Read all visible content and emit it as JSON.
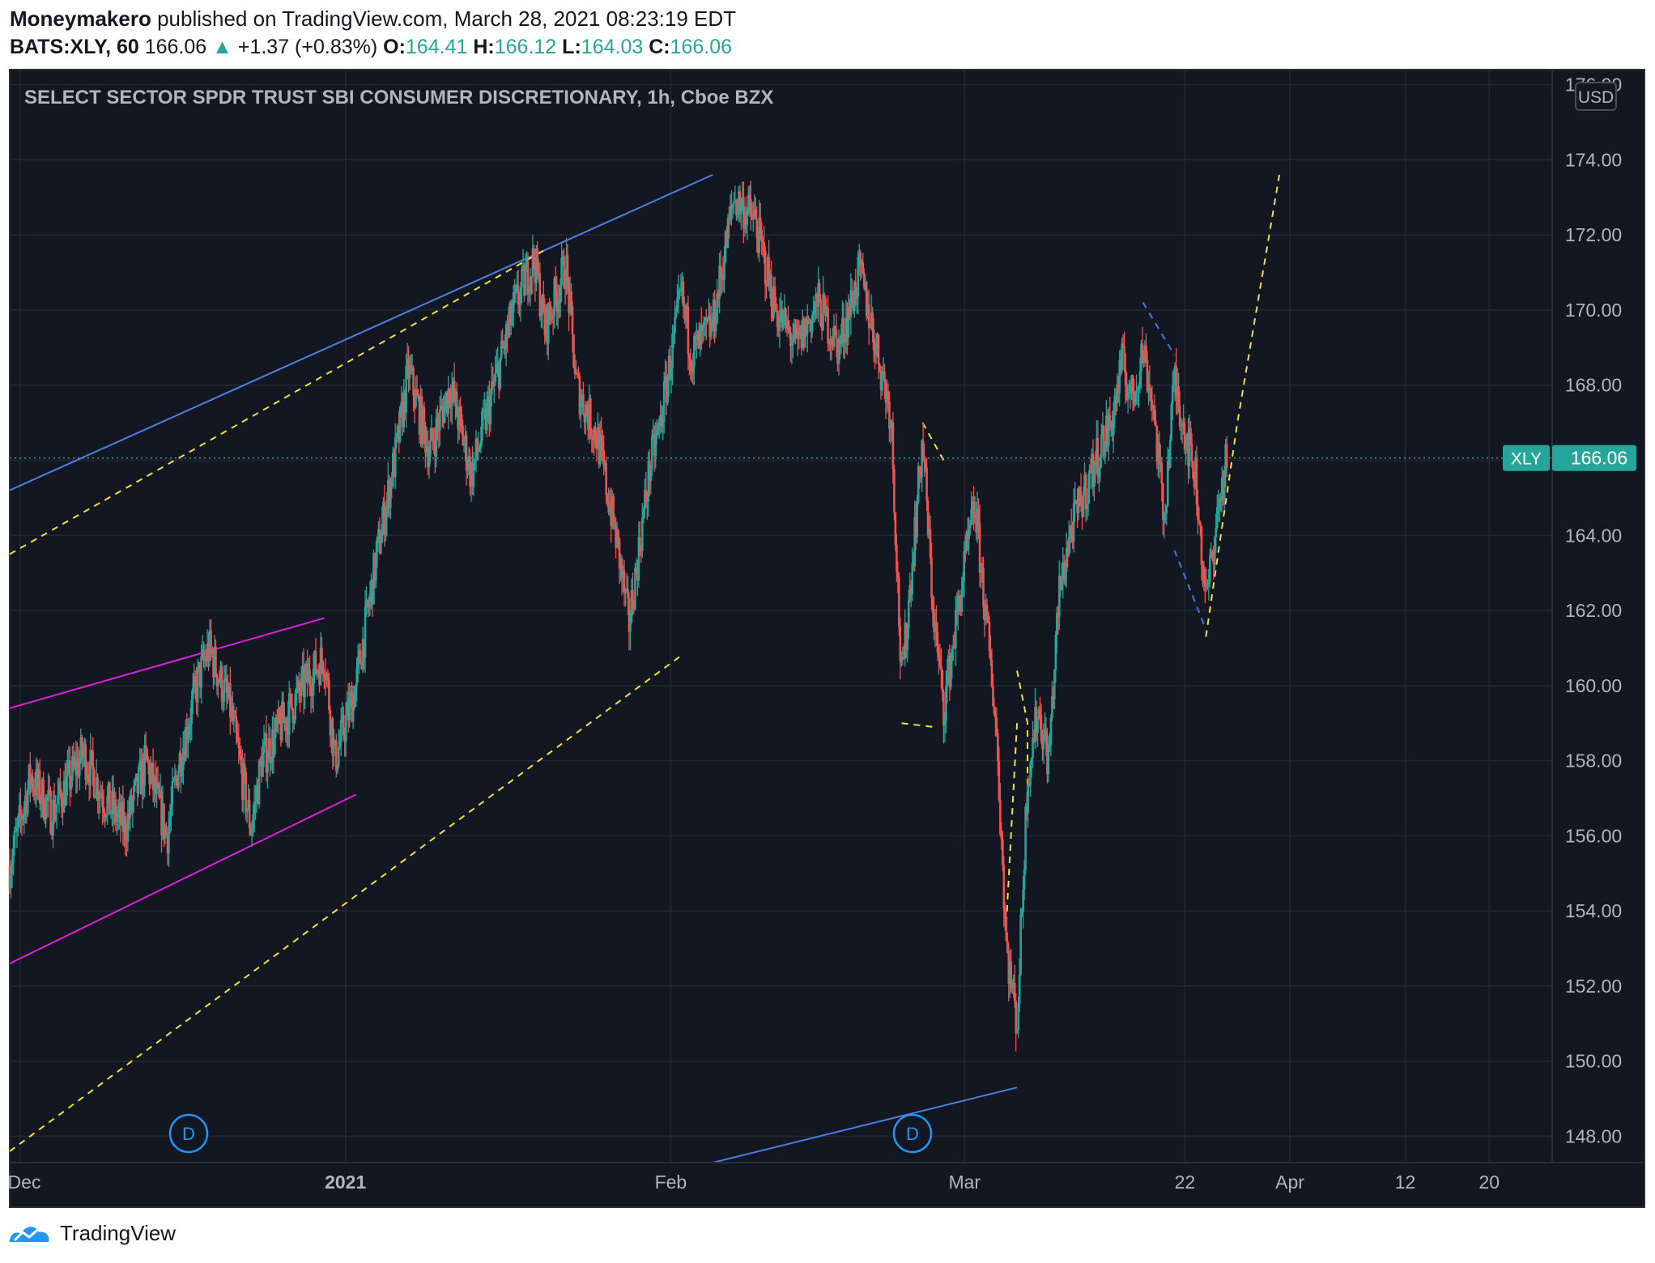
{
  "header": {
    "author": "Moneymakero",
    "published_text": "published on TradingView.com, March 28, 2021 08:23:19 EDT",
    "symbol": "BATS:XLY, 60",
    "last": "166.06",
    "change_arrow": "▲",
    "change": "+1.37 (+0.83%)",
    "o_label": "O:",
    "o_value": "164.41",
    "h_label": "H:",
    "h_value": "166.12",
    "l_label": "L:",
    "l_value": "164.03",
    "c_label": "C:",
    "c_value": "166.06"
  },
  "chart_title": "SELECT SECTOR SPDR TRUST SBI CONSUMER DISCRETIONARY, 1h, Cboe BZX",
  "currency_label": "USD",
  "price_badge": {
    "symbol": "XLY",
    "value": "166.06"
  },
  "dividend_markers": [
    "D",
    "D"
  ],
  "footer_brand": "TradingView",
  "colors": {
    "background": "#131722",
    "grid": "#242833",
    "up": "#26a69a",
    "down": "#ef5350",
    "axis_text": "#b2b5be",
    "blue_line": "#4c7fe0",
    "magenta_line": "#e020d8",
    "yellow_dash": "#f3e23a",
    "blue_dash": "#3d7fe6"
  },
  "chart_data": {
    "type": "candlestick",
    "title": "SELECT SECTOR SPDR TRUST SBI CONSUMER DISCRETIONARY, 1h, Cboe BZX",
    "last_price": 166.06,
    "y_axis": {
      "ticks": [
        148,
        150,
        152,
        154,
        156,
        158,
        160,
        162,
        164,
        166,
        168,
        170,
        172,
        174,
        176
      ],
      "tick_labels": [
        "148.00",
        "150.00",
        "152.00",
        "154.00",
        "156.00",
        "158.00",
        "160.00",
        "162.00",
        "164.00",
        "166.00",
        "168.00",
        "170.00",
        "172.00",
        "174.00",
        "176.00"
      ],
      "ylim": [
        147.3,
        176.4
      ]
    },
    "x_axis": {
      "tick_labels": [
        "Dec",
        "2021",
        "Feb",
        "Mar",
        "22",
        "Apr",
        "12",
        "20"
      ],
      "tick_dates": [
        "2020-12-01",
        "2021-01-01",
        "2021-02-01",
        "2021-03-01",
        "2021-03-22",
        "2021-04-01",
        "2021-04-12",
        "2021-04-20"
      ],
      "xlim": [
        "2020-11-30",
        "2021-04-26"
      ]
    },
    "grid": true,
    "price_path": [
      [
        "2020-11-30",
        155.2
      ],
      [
        "2020-12-02",
        157.6
      ],
      [
        "2020-12-04",
        156.6
      ],
      [
        "2020-12-07",
        158.2
      ],
      [
        "2020-12-09",
        157.0
      ],
      [
        "2020-12-11",
        156.2
      ],
      [
        "2020-12-13",
        158.0
      ],
      [
        "2020-12-15",
        156.0
      ],
      [
        "2020-12-16",
        157.8
      ],
      [
        "2020-12-18",
        160.2
      ],
      [
        "2020-12-19",
        161.0
      ],
      [
        "2020-12-21",
        159.4
      ],
      [
        "2020-12-23",
        156.2
      ],
      [
        "2020-12-24",
        158.0
      ],
      [
        "2020-12-26",
        159.0
      ],
      [
        "2020-12-28",
        160.0
      ],
      [
        "2020-12-30",
        160.8
      ],
      [
        "2020-12-31",
        158.0
      ],
      [
        "2021-01-02",
        160.0
      ],
      [
        "2021-01-04",
        163.5
      ],
      [
        "2021-01-06",
        166.5
      ],
      [
        "2021-01-07",
        168.4
      ],
      [
        "2021-01-09",
        166.2
      ],
      [
        "2021-01-11",
        168.0
      ],
      [
        "2021-01-13",
        165.6
      ],
      [
        "2021-01-15",
        167.8
      ],
      [
        "2021-01-17",
        170.0
      ],
      [
        "2021-01-19",
        171.4
      ],
      [
        "2021-01-20",
        169.5
      ],
      [
        "2021-01-22",
        171.2
      ],
      [
        "2021-01-23",
        168.0
      ],
      [
        "2021-01-25",
        166.6
      ],
      [
        "2021-01-27",
        163.6
      ],
      [
        "2021-01-28",
        161.6
      ],
      [
        "2021-01-30",
        165.8
      ],
      [
        "2021-01-31",
        167.0
      ],
      [
        "2021-02-02",
        170.4
      ],
      [
        "2021-02-03",
        168.8
      ],
      [
        "2021-02-05",
        169.6
      ],
      [
        "2021-02-07",
        173.0
      ],
      [
        "2021-02-09",
        172.4
      ],
      [
        "2021-02-11",
        170.0
      ],
      [
        "2021-02-13",
        169.0
      ],
      [
        "2021-02-15",
        170.2
      ],
      [
        "2021-02-17",
        169.0
      ],
      [
        "2021-02-19",
        171.0
      ],
      [
        "2021-02-20",
        169.8
      ],
      [
        "2021-02-22",
        167.2
      ],
      [
        "2021-02-23",
        160.0
      ],
      [
        "2021-02-25",
        166.6
      ],
      [
        "2021-02-26",
        162.0
      ],
      [
        "2021-02-27",
        159.4
      ],
      [
        "2021-03-01",
        163.2
      ],
      [
        "2021-03-02",
        164.8
      ],
      [
        "2021-03-04",
        159.0
      ],
      [
        "2021-03-05",
        153.0
      ],
      [
        "2021-03-06",
        151.0
      ],
      [
        "2021-03-07",
        157.6
      ],
      [
        "2021-03-08",
        159.4
      ],
      [
        "2021-03-09",
        158.0
      ],
      [
        "2021-03-10",
        162.4
      ],
      [
        "2021-03-11",
        164.0
      ],
      [
        "2021-03-13",
        165.6
      ],
      [
        "2021-03-14",
        166.4
      ],
      [
        "2021-03-15",
        167.0
      ],
      [
        "2021-03-16",
        168.6
      ],
      [
        "2021-03-17",
        167.6
      ],
      [
        "2021-03-18",
        169.0
      ],
      [
        "2021-03-19",
        167.4
      ],
      [
        "2021-03-20",
        164.4
      ],
      [
        "2021-03-21",
        168.2
      ],
      [
        "2021-03-22",
        166.8
      ],
      [
        "2021-03-23",
        165.6
      ],
      [
        "2021-03-24",
        162.2
      ],
      [
        "2021-03-25",
        164.4
      ],
      [
        "2021-03-26",
        166.06
      ]
    ],
    "drawings": [
      {
        "kind": "line",
        "color": "blue",
        "points": [
          [
            "2020-11-30",
            165.2
          ],
          [
            "2021-02-05",
            173.6
          ]
        ]
      },
      {
        "kind": "line",
        "color": "blue",
        "points": [
          [
            "2021-02-05",
            147.3
          ],
          [
            "2021-03-06",
            149.3
          ]
        ]
      },
      {
        "kind": "line",
        "color": "magenta",
        "points": [
          [
            "2020-11-30",
            159.4
          ],
          [
            "2020-12-30",
            161.8
          ]
        ]
      },
      {
        "kind": "line",
        "color": "magenta",
        "points": [
          [
            "2020-11-30",
            152.6
          ],
          [
            "2021-01-02",
            157.1
          ]
        ]
      },
      {
        "kind": "dashed",
        "color": "yellow",
        "points": [
          [
            "2020-11-30",
            163.5
          ],
          [
            "2021-01-20",
            171.6
          ]
        ]
      },
      {
        "kind": "dashed",
        "color": "yellow",
        "points": [
          [
            "2020-11-30",
            147.6
          ],
          [
            "2021-02-02",
            160.8
          ]
        ]
      },
      {
        "kind": "dashed",
        "color": "yellow",
        "points": [
          [
            "2021-02-25",
            167.0
          ],
          [
            "2021-02-27",
            166.0
          ]
        ]
      },
      {
        "kind": "dashed",
        "color": "yellow",
        "points": [
          [
            "2021-02-23",
            159.0
          ],
          [
            "2021-02-26",
            158.9
          ]
        ]
      },
      {
        "kind": "dashed",
        "color": "yellow",
        "points": [
          [
            "2021-03-06",
            160.4
          ],
          [
            "2021-03-07",
            159.0
          ],
          [
            "2021-03-07",
            157.0
          ]
        ]
      },
      {
        "kind": "dashed",
        "color": "yellow",
        "points": [
          [
            "2021-03-06",
            159.0
          ],
          [
            "2021-03-05",
            153.8
          ]
        ]
      },
      {
        "kind": "dashed",
        "color": "yellow",
        "points": [
          [
            "2021-03-24",
            161.3
          ],
          [
            "2021-03-27",
            167.0
          ],
          [
            "2021-03-31",
            173.6
          ]
        ]
      },
      {
        "kind": "dashed",
        "color": "blueDash",
        "points": [
          [
            "2021-03-18",
            170.2
          ],
          [
            "2021-03-21",
            168.8
          ]
        ]
      },
      {
        "kind": "dashed",
        "color": "blueDash",
        "points": [
          [
            "2021-03-21",
            163.6
          ],
          [
            "2021-03-24",
            161.5
          ]
        ]
      }
    ]
  }
}
